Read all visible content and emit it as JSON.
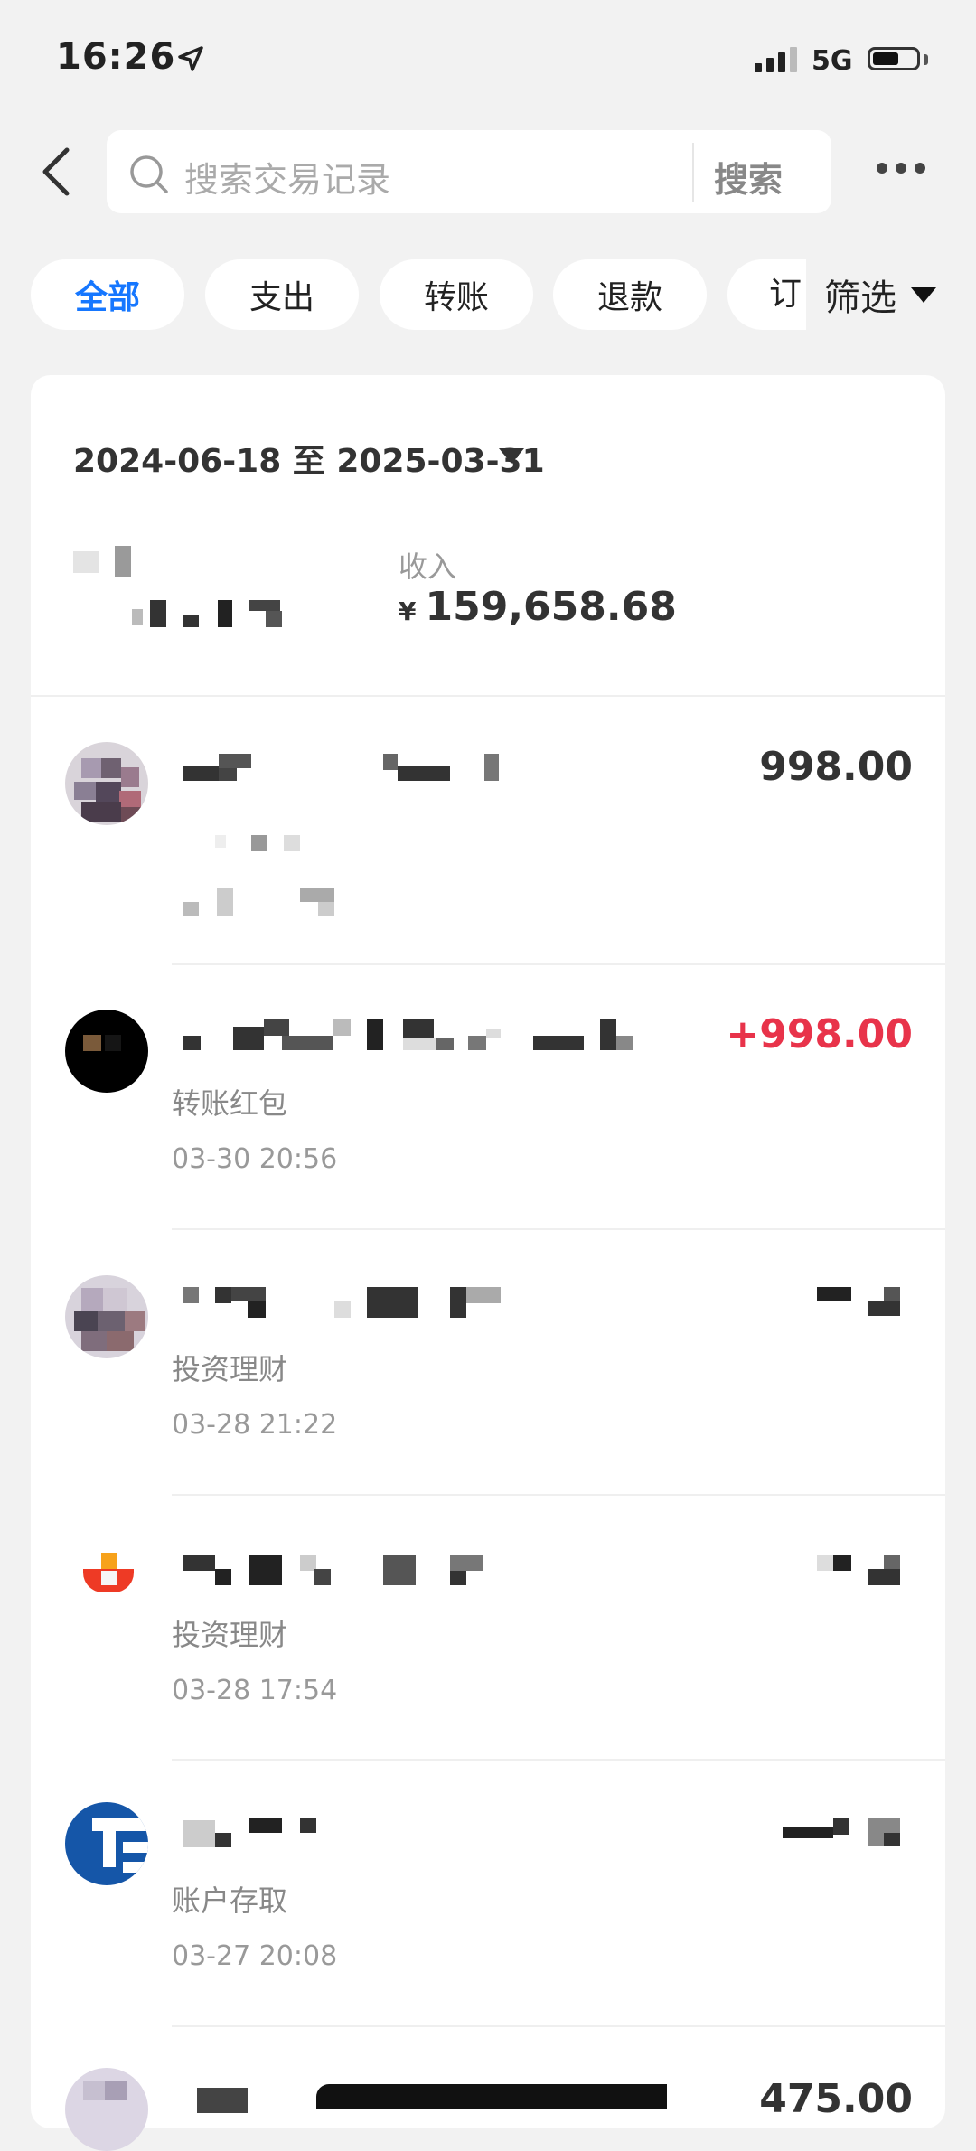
{
  "status_bar": {
    "time": "16:26",
    "network": "5G"
  },
  "header": {
    "search_placeholder": "搜索交易记录",
    "search_button": "搜索"
  },
  "tabs": [
    {
      "label": "全部",
      "active": true
    },
    {
      "label": "支出",
      "active": false
    },
    {
      "label": "转账",
      "active": false
    },
    {
      "label": "退款",
      "active": false
    },
    {
      "label": "订",
      "active": false
    }
  ],
  "filter": {
    "label": "筛选"
  },
  "summary": {
    "date_range": "2024-06-18 至 2025-03-31",
    "income_label": "收入",
    "income_currency": "¥",
    "income_value": "159,658.68"
  },
  "transactions": [
    {
      "amount": "998.00",
      "category": "",
      "time": ""
    },
    {
      "amount": "+998.00",
      "category": "转账红包",
      "time": "03-30 20:56"
    },
    {
      "amount": "",
      "category": "投资理财",
      "time": "03-28 21:22"
    },
    {
      "amount": "",
      "category": "投资理财",
      "time": "03-28 17:54"
    },
    {
      "amount": "",
      "category": "账户存取",
      "time": "03-27 20:08"
    },
    {
      "amount": "475.00",
      "category": "",
      "time": ""
    }
  ],
  "colors": {
    "accent": "#1677ff",
    "positive_amount": "#e8334a",
    "background": "#f2f2f2"
  }
}
